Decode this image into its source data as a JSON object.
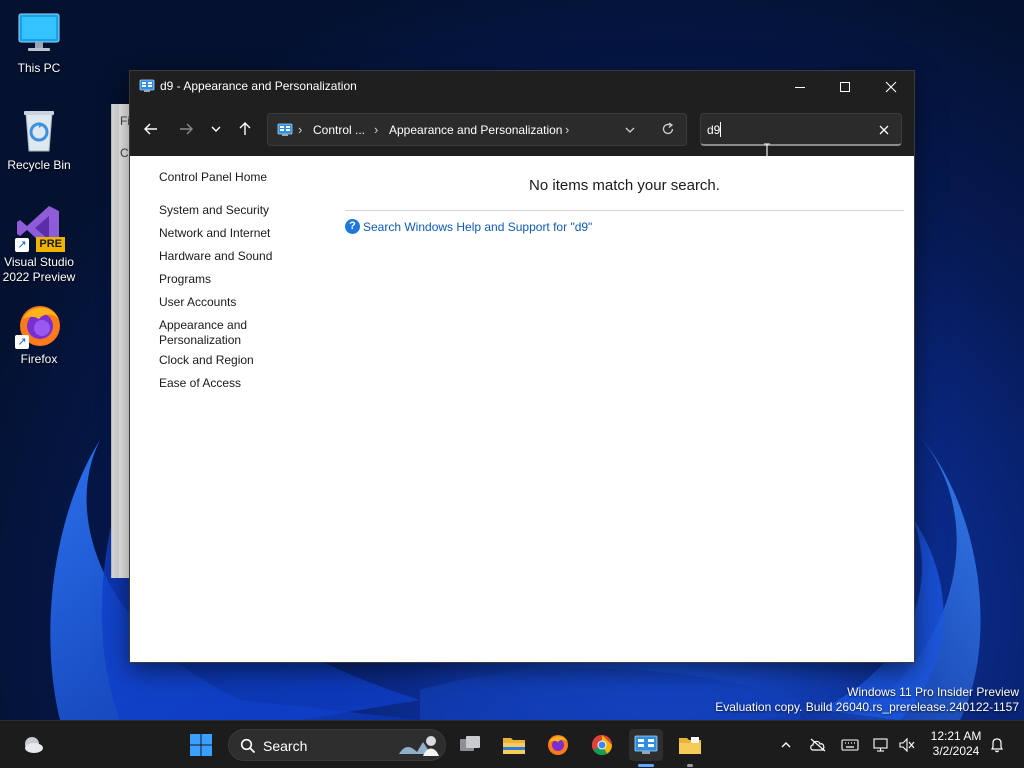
{
  "desktop": {
    "icons": [
      {
        "label": "This PC",
        "icon": "monitor-icon"
      },
      {
        "label": "Recycle Bin",
        "icon": "recycle-bin-icon"
      },
      {
        "label": "Visual Studio\n2022 Preview",
        "icon": "visual-studio-icon",
        "badge": "PRE"
      },
      {
        "label": "Firefox",
        "icon": "firefox-icon"
      }
    ],
    "watermark": {
      "line1": "Windows 11 Pro Insider Preview",
      "line2": "Evaluation copy. Build 26040.rs_prerelease.240122-1157"
    }
  },
  "background_window": {
    "text_a": "Fi",
    "text_b": "C"
  },
  "window": {
    "title": "d9 - Appearance and Personalization",
    "address": {
      "icon": "control-panel-icon",
      "crumbs": [
        "Control ...",
        "Appearance and Personalization"
      ]
    },
    "search": {
      "value": "d9"
    },
    "left_nav": {
      "home": "Control Panel Home",
      "items": [
        "System and Security",
        "Network and Internet",
        "Hardware and Sound",
        "Programs",
        "User Accounts",
        "Appearance and\nPersonalization",
        "Clock and Region",
        "Ease of Access"
      ]
    },
    "main": {
      "empty_message": "No items match your search.",
      "help_link": "Search Windows Help and Support for \"d9\""
    }
  },
  "taskbar": {
    "search_label": "Search",
    "clock": {
      "time": "12:21 AM",
      "date": "3/2/2024"
    }
  },
  "colors": {
    "titlebar": "#1f1f1f",
    "link": "#0f5ab8",
    "taskbar": "#1c1c1c",
    "accent": "#60a8ff"
  }
}
